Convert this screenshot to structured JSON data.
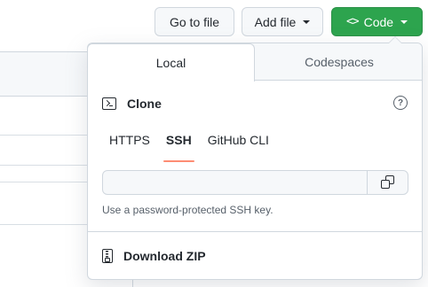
{
  "toolbar": {
    "go_to_file_label": "Go to file",
    "add_file_label": "Add file",
    "code_label": "Code",
    "code_icon_glyph": "<>"
  },
  "popover": {
    "tabs": [
      {
        "label": "Local",
        "selected": true
      },
      {
        "label": "Codespaces",
        "selected": false
      }
    ],
    "clone": {
      "title": "Clone",
      "help_glyph": "?",
      "protocols": [
        {
          "label": "HTTPS",
          "selected": false
        },
        {
          "label": "SSH",
          "selected": true
        },
        {
          "label": "GitHub CLI",
          "selected": false
        }
      ],
      "url_value": "",
      "hint": "Use a password-protected SSH key."
    },
    "download_zip_label": "Download ZIP"
  },
  "colors": {
    "primary_button": "#2da44e",
    "active_underline": "#fd8c73",
    "border": "#d0d7de",
    "muted_text": "#57606a"
  }
}
